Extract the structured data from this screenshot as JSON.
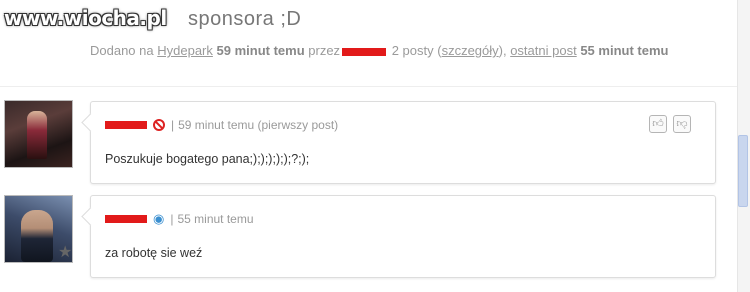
{
  "watermark": "www.wiocha.pl",
  "thread": {
    "title_suffix": "sponsora ;D",
    "meta": {
      "prefix": "Dodano na",
      "board": "Hydepark",
      "time": "59 minut temu",
      "by": "przez",
      "posts": "2 posty",
      "details_link": "szczegóły",
      "last_post_link": "ostatni post",
      "last_post_time": "55 minut temu"
    }
  },
  "posts": [
    {
      "time": "59 minut temu (pierwszy post)",
      "body": "Poszukuje bogatego pana;);););););?;);",
      "status_icon": "ban-icon"
    },
    {
      "time": "55 minut temu",
      "body": "za robotę sie weź",
      "status_icon": "eye-icon"
    }
  ],
  "icons": {
    "thumb_up": "thumb-up-icon",
    "thumb_down": "thumb-down-icon",
    "star": "star-icon"
  }
}
